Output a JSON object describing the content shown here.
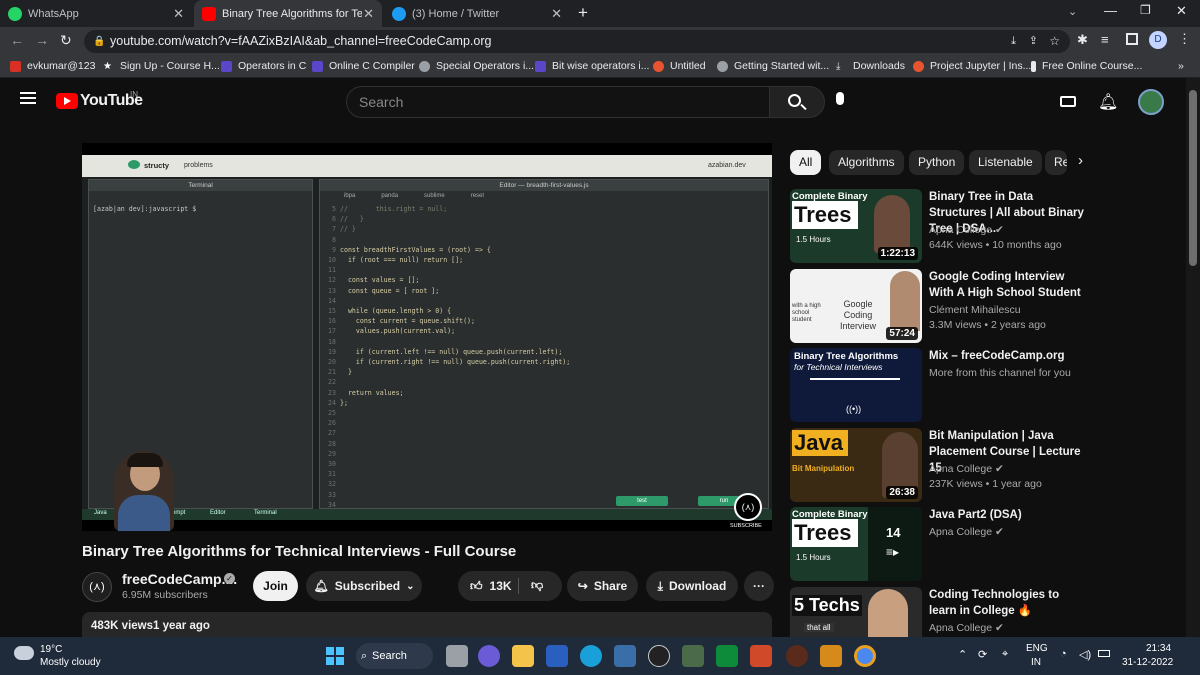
{
  "browser": {
    "tabs": [
      {
        "title": "WhatsApp",
        "active": false,
        "color": "#25d366"
      },
      {
        "title": "Binary Tree Algorithms for Te",
        "active": true,
        "color": "#ff0000"
      },
      {
        "title": "(3) Home / Twitter",
        "active": false,
        "color": "#1d9bf0"
      }
    ],
    "new_tab": "+",
    "url": "youtube.com/watch?v=fAAZixBzIAI&ab_channel=freeCodeCamp.org",
    "bookmarks": [
      "evkumar@123",
      "Sign Up - Course H...",
      "Operators in C",
      "Online C Compiler",
      "Special Operators i...",
      "Bit wise operators i...",
      "Untitled",
      "Getting Started wit...",
      "Downloads",
      "Project Jupyter | Ins...",
      "Free Online Course..."
    ],
    "bookmarks_more": "»",
    "profile_initial": "D"
  },
  "youtube": {
    "logo_text": "YouTube",
    "country": "IN",
    "search_placeholder": "Search"
  },
  "video": {
    "title": "Binary Tree Algorithms for Technical Interviews - Full Course",
    "channel": "freeCodeCamp....",
    "subscribers": "6.95M subscribers",
    "join": "Join",
    "subscribed": "Subscribed",
    "likes": "13K",
    "share": "Share",
    "download": "Download",
    "more": "···",
    "views": "483K views",
    "age": "1 year ago",
    "watermark": "SUBSCRIBE"
  },
  "ide": {
    "brand": "structy",
    "nav": "problems",
    "user": "azabian.dev",
    "terminal_title": "Terminal",
    "terminal_prompt": "[azab|an dev]:javascript $",
    "editor_title": "Editor — breadth-first-values.js",
    "editor_tabs": [
      "ibpa",
      "panda",
      "sublime",
      "reset"
    ],
    "code_lines": [
      "//       this.right = null;",
      "//   }",
      "// }",
      "",
      "const breadthFirstValues = (root) => {",
      "  if (root === null) return [];",
      "",
      "  const values = [];",
      "  const queue = [ root ];",
      "",
      "  while (queue.length > 0) {",
      "    const current = queue.shift();",
      "    values.push(current.val);",
      "",
      "    if (current.left !== null) queue.push(current.left);",
      "    if (current.right !== null) queue.push(current.right);",
      "  }",
      "",
      "  return values;",
      "};",
      "",
      "",
      "",
      "",
      "",
      "",
      "",
      "",
      "",
      "",
      ""
    ],
    "line_start": 5,
    "test_button": "test",
    "run_button": "run",
    "bottom_tabs": [
      "Java",
      "ompt",
      "Editor",
      "Terminal"
    ]
  },
  "chips": [
    "All",
    "Algorithms",
    "Python",
    "Listenable",
    "Re"
  ],
  "recommendations": [
    {
      "title": "Binary Tree in Data Structures | All about Binary Tree | DSA...",
      "channel": "Apna College",
      "verified": true,
      "meta": "644K views • 10 months ago",
      "duration": "1:22:13",
      "thumb_text": "Complete Binary",
      "thumb_big": "Trees",
      "thumb_sub": "1.5 Hours",
      "bg": "#1c3a2a"
    },
    {
      "title": "Google Coding Interview With A High School Student",
      "channel": "Clément Mihailescu",
      "verified": false,
      "meta": "3.3M views • 2 years ago",
      "duration": "57:24",
      "thumb_text": "Google Coding Interview",
      "thumb_big": "",
      "thumb_sub": "with a high school student",
      "bg": "#f2f2f2"
    },
    {
      "title": "Mix – freeCodeCamp.org",
      "channel": "More from this channel for you",
      "verified": false,
      "meta": "",
      "duration": "",
      "thumb_text": "Binary Tree Algorithms",
      "thumb_big": "",
      "thumb_sub": "for Technical Interviews",
      "bg": "#0f1a3a"
    },
    {
      "title": "Bit Manipulation | Java Placement Course | Lecture 15",
      "channel": "Apna College",
      "verified": true,
      "meta": "237K views • 1 year ago",
      "duration": "26:38",
      "thumb_text": "Java",
      "thumb_big": "",
      "thumb_sub": "Bit Manipulation",
      "bg": "#3a2a14"
    },
    {
      "title": "Java Part2 (DSA)",
      "channel": "Apna College",
      "verified": true,
      "meta": "",
      "duration": "",
      "thumb_text": "Complete Binary",
      "thumb_big": "Trees",
      "thumb_sub": "1.5 Hours",
      "bg": "#1c3a2a",
      "playlist_count": "14"
    },
    {
      "title": "Coding Technologies to learn in College 🔥",
      "channel": "Apna College",
      "verified": true,
      "meta": "",
      "duration": "",
      "thumb_text": "5 Techs",
      "thumb_big": "",
      "thumb_sub": "that all",
      "bg": "#2a2a2a"
    }
  ],
  "taskbar": {
    "weather_temp": "19°C",
    "weather_desc": "Mostly cloudy",
    "search": "Search",
    "lang": "ENG",
    "region": "IN",
    "time": "21:34",
    "date": "31-12-2022"
  }
}
